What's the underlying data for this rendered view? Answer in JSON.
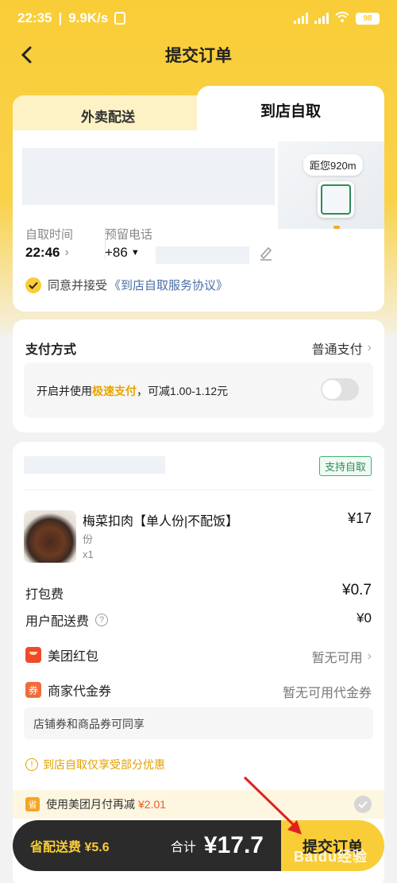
{
  "status_bar": {
    "time": "22:35",
    "net_speed": "9.9K/s",
    "battery": "98"
  },
  "nav": {
    "title": "提交订单"
  },
  "tabs": {
    "delivery": "外卖配送",
    "pickup": "到店自取"
  },
  "pickup": {
    "distance": "距您920m",
    "time_label": "自取时间",
    "time_value": "22:46",
    "phone_label": "预留电话",
    "phone_prefix": "+86",
    "agree_text": "同意并接受",
    "agree_link": "《到店自取服务协议》"
  },
  "payment": {
    "title": "支付方式",
    "method": "普通支付",
    "fast_pre": "开启并使用",
    "fast_hl": "极速支付",
    "fast_post": "，可减1.00-1.12元"
  },
  "order": {
    "support_badge": "支持自取",
    "dish": {
      "name": "梅菜扣肉【单人份|不配饭】",
      "sub": "份",
      "qty": "x1",
      "price": "¥17"
    },
    "packing_label": "打包费",
    "packing_value": "¥0.7",
    "delivery_label": "用户配送费",
    "delivery_value": "¥0",
    "redpack_label": "美团红包",
    "redpack_value": "暂无可用",
    "coupon_icon": "券",
    "coupon_label": "商家代金券",
    "coupon_value": "暂无可用代金券",
    "coupon_note": "店铺券和商品券可同享",
    "partial_note": "到店自取仅享受部分优惠",
    "monthly_icon": "省",
    "monthly_text": "使用美团月付再减",
    "monthly_amount": "¥2.01"
  },
  "bottom": {
    "save": "省配送费 ¥5.6",
    "total_label": "合计",
    "total": "¥17.7",
    "submit": "提交订单"
  },
  "watermark": "Baidu经验",
  "colors": {
    "brand_yellow": "#f9cd37",
    "accent_orange": "#e8a500",
    "dark_bar": "#2b2b2b",
    "green_badge": "#2e8b57"
  }
}
